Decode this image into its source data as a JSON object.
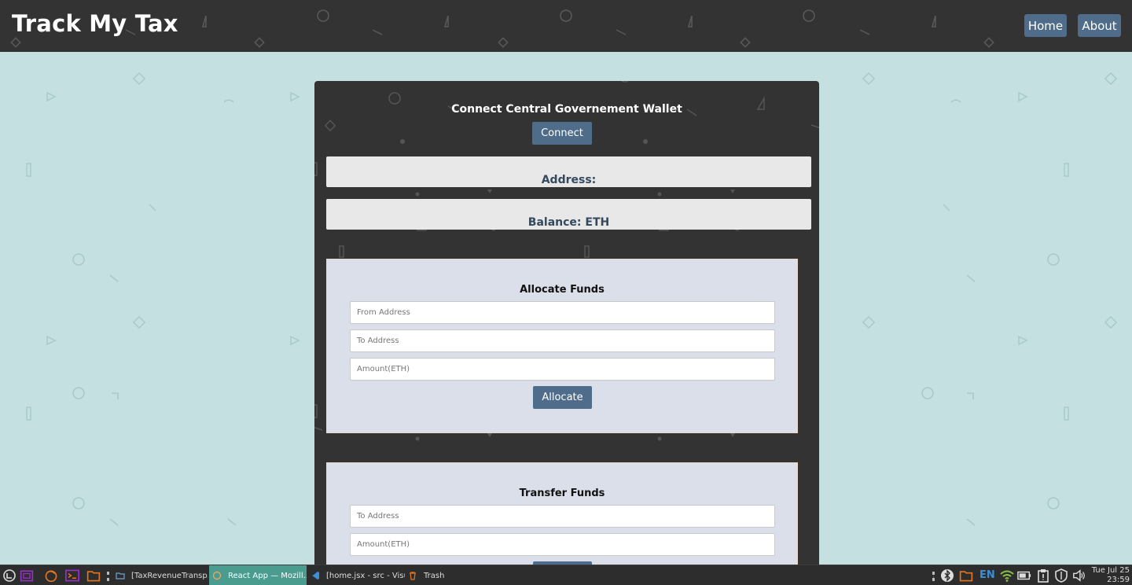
{
  "app": {
    "brand": "Track My Tax",
    "nav": {
      "home": "Home",
      "about": "About"
    }
  },
  "wallet": {
    "title": "Connect Central Governement Wallet",
    "connect_label": "Connect",
    "address_label": "Address:",
    "balance_label": "Balance: ETH"
  },
  "allocate": {
    "title": "Allocate Funds",
    "from_placeholder": "From Address",
    "to_placeholder": "To Address",
    "amount_placeholder": "Amount(ETH)",
    "button_label": "Allocate"
  },
  "transfer": {
    "title": "Transfer Funds",
    "to_placeholder": "To Address",
    "amount_placeholder": "Amount(ETH)"
  },
  "taskbar": {
    "tasks": [
      {
        "label": "[TaxRevenueTransp...",
        "icon": "folder-icon"
      },
      {
        "label": "React App — Mozill...",
        "icon": "firefox-icon"
      },
      {
        "label": "[home.jsx - src - Visu...",
        "icon": "vscode-icon"
      },
      {
        "label": "Trash",
        "icon": "trash-icon"
      }
    ],
    "language": "EN",
    "clock": {
      "date": "Tue Jul 25",
      "time": "23:59"
    }
  },
  "colors": {
    "page_bg": "#c4e0e0",
    "dark_panel": "#333333",
    "accent_button": "#4f6d8a",
    "card_bg": "#dadfea",
    "info_box_bg": "#e8e8e8",
    "taskbar_active": "#4a9c8f",
    "taskbar_icon_accent": "#e8761c",
    "taskbar_icon_purple": "#9b2fc9"
  }
}
